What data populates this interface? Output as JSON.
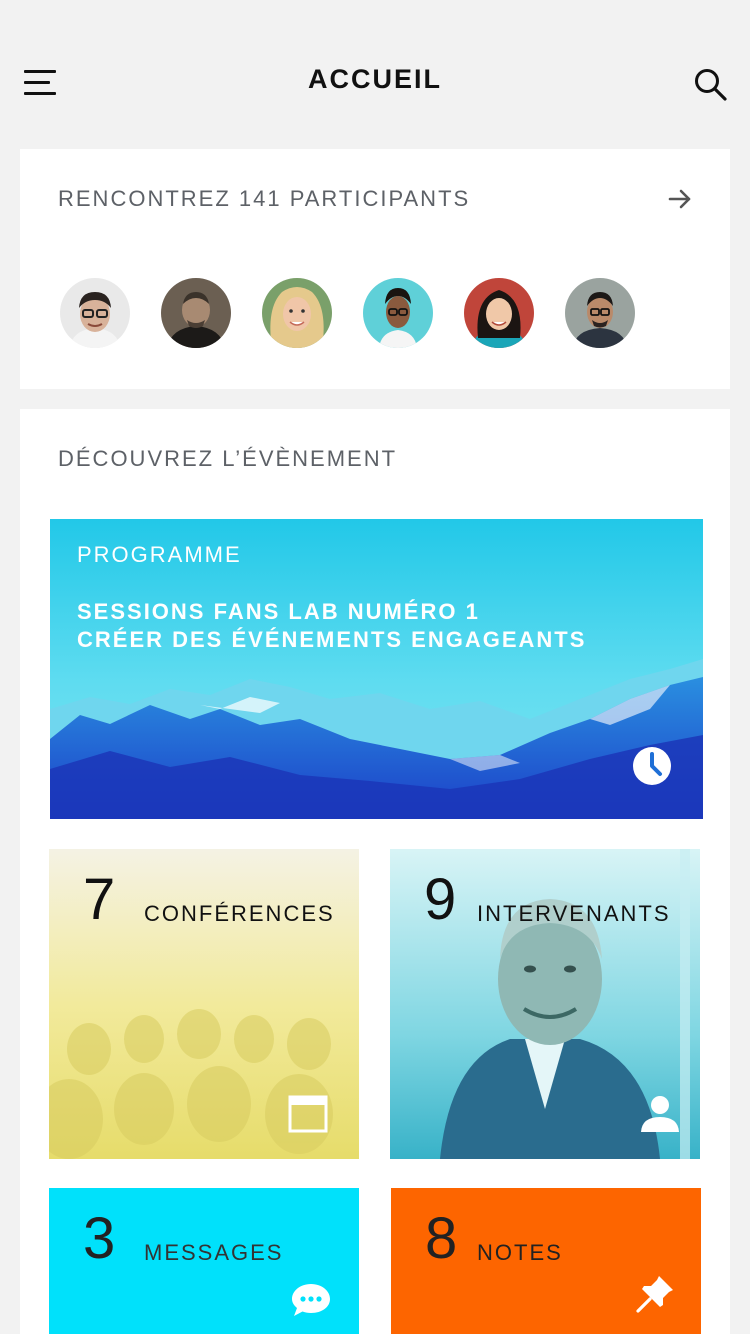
{
  "header": {
    "title": "ACCUEIL",
    "menu_icon": "hamburger-menu-icon",
    "search_icon": "search-icon"
  },
  "participants": {
    "title": "RENCONTREZ 141 PARTICIPANTS",
    "arrow_icon": "arrow-right-icon",
    "avatars": [
      {
        "name": "avatar-1"
      },
      {
        "name": "avatar-2"
      },
      {
        "name": "avatar-3"
      },
      {
        "name": "avatar-4"
      },
      {
        "name": "avatar-5"
      },
      {
        "name": "avatar-6"
      }
    ]
  },
  "event": {
    "title": "DÉCOUVREZ L’ÉVÈNEMENT",
    "programme": {
      "label": "PROGRAMME",
      "line1": "SESSIONS FANS LAB NUMÉRO 1",
      "line2": "CRÉER DES ÉVÉNEMENTS ENGAGEANTS",
      "icon": "clock-icon"
    },
    "tiles": {
      "conferences": {
        "count": "7",
        "label": "CONFÉRENCES",
        "icon": "calendar-icon",
        "color": "#f3eeb0"
      },
      "speakers": {
        "count": "9",
        "label": "INTERVENANTS",
        "icon": "person-icon",
        "color": "#7fd9e4"
      },
      "messages": {
        "count": "3",
        "label": "MESSAGES",
        "icon": "chat-bubble-icon",
        "color": "#00e1fb"
      },
      "notes": {
        "count": "8",
        "label": "NOTES",
        "icon": "pin-icon",
        "color": "#fd6500"
      }
    }
  }
}
